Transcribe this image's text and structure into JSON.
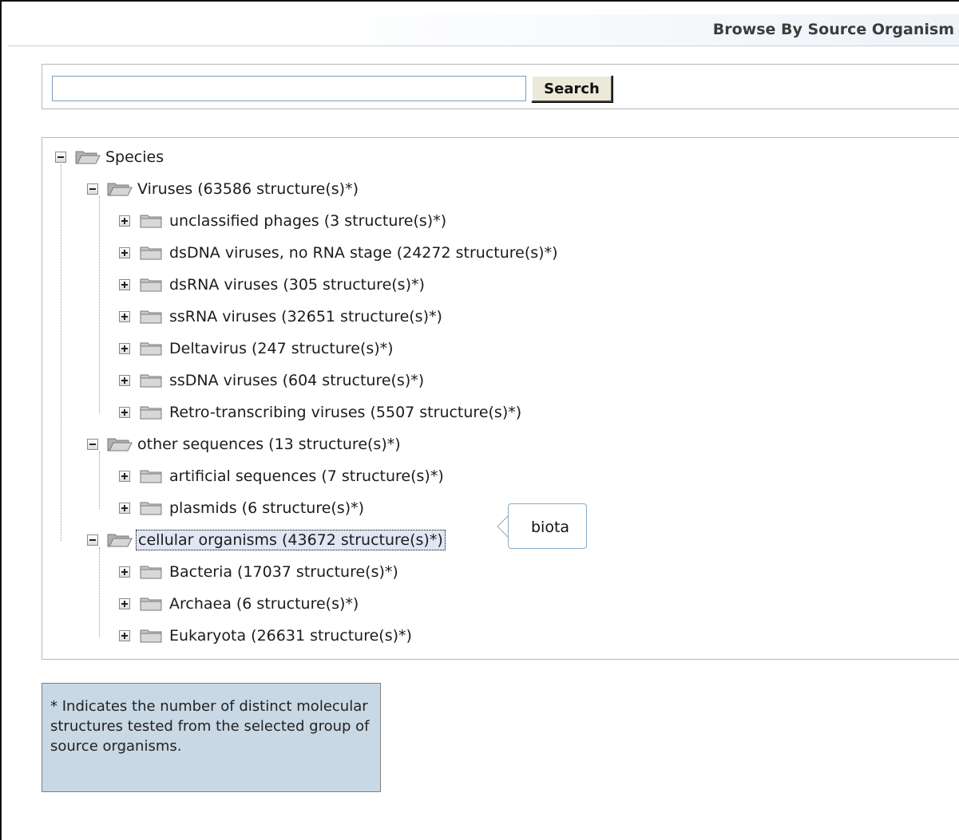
{
  "header": {
    "title": "Browse By Source Organism"
  },
  "search": {
    "value": "",
    "placeholder": "",
    "button_label": "Search"
  },
  "tree": {
    "root": {
      "label": "Species",
      "expanded": true
    },
    "groups": [
      {
        "label": "Viruses (63586 structure(s)*)",
        "expanded": true,
        "children": [
          "unclassified phages (3 structure(s)*)",
          "dsDNA viruses, no RNA stage (24272 structure(s)*)",
          "dsRNA viruses (305 structure(s)*)",
          "ssRNA viruses (32651 structure(s)*)",
          "Deltavirus (247 structure(s)*)",
          "ssDNA viruses (604 structure(s)*)",
          "Retro-transcribing viruses (5507 structure(s)*)"
        ]
      },
      {
        "label": "other sequences (13 structure(s)*)",
        "expanded": true,
        "children": [
          "artificial sequences (7 structure(s)*)",
          "plasmids (6 structure(s)*)"
        ]
      },
      {
        "label": "cellular organisms (43672 structure(s)*)",
        "expanded": true,
        "selected": true,
        "children": [
          "Bacteria (17037 structure(s)*)",
          "Archaea (6 structure(s)*)",
          "Eukaryota (26631 structure(s)*)"
        ]
      }
    ]
  },
  "tooltip": {
    "text": "biota"
  },
  "footnote": {
    "text": "* Indicates the number of distinct molecular structures tested from the selected group of source organisms."
  },
  "colors": {
    "footnote_bg": "#c9d8e5",
    "selected_bg": "#dfe6f4",
    "tooltip_border": "#88aec6"
  }
}
